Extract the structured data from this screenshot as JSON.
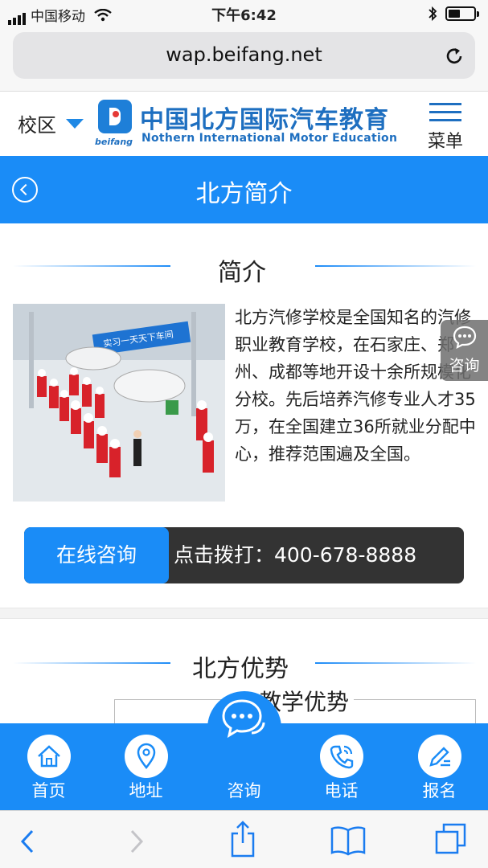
{
  "status": {
    "carrier": "中国移动",
    "time": "下午6:42"
  },
  "browser": {
    "url": "wap.beifang.net"
  },
  "header": {
    "campus": "校区",
    "logo_title": "中国北方国际汽车教育",
    "logo_en": "Nothern International Motor Education",
    "logo_sub": "beifang",
    "menu_label": "菜单"
  },
  "titlebar": {
    "title": "北方简介"
  },
  "intro": {
    "heading": "简介",
    "photo_banner": "实习一天天下车间",
    "text": "北方汽修学校是全国知名的汽修职业教育学校，在石家庄、郑州、成都等地开设十余所规模化分校。先后培养汽修专业人才35万，在全国建立36所就业分配中心，推荐范围遍及全国。"
  },
  "side_consult": {
    "label": "咨询"
  },
  "callbar": {
    "online_label": "在线咨询",
    "call_text": "点击拨打：400-678-8888"
  },
  "advantages": {
    "heading": "北方优势",
    "subheading": "教学优势"
  },
  "bottom_nav": {
    "items": [
      {
        "label": "首页",
        "icon": "home-icon"
      },
      {
        "label": "地址",
        "icon": "location-pin-icon"
      },
      {
        "label": "咨询",
        "icon": "chat-bubble-icon"
      },
      {
        "label": "电话",
        "icon": "phone-icon"
      },
      {
        "label": "报名",
        "icon": "pen-icon"
      }
    ]
  },
  "colors": {
    "primary": "#1a8cf7",
    "dark": "#333333"
  }
}
